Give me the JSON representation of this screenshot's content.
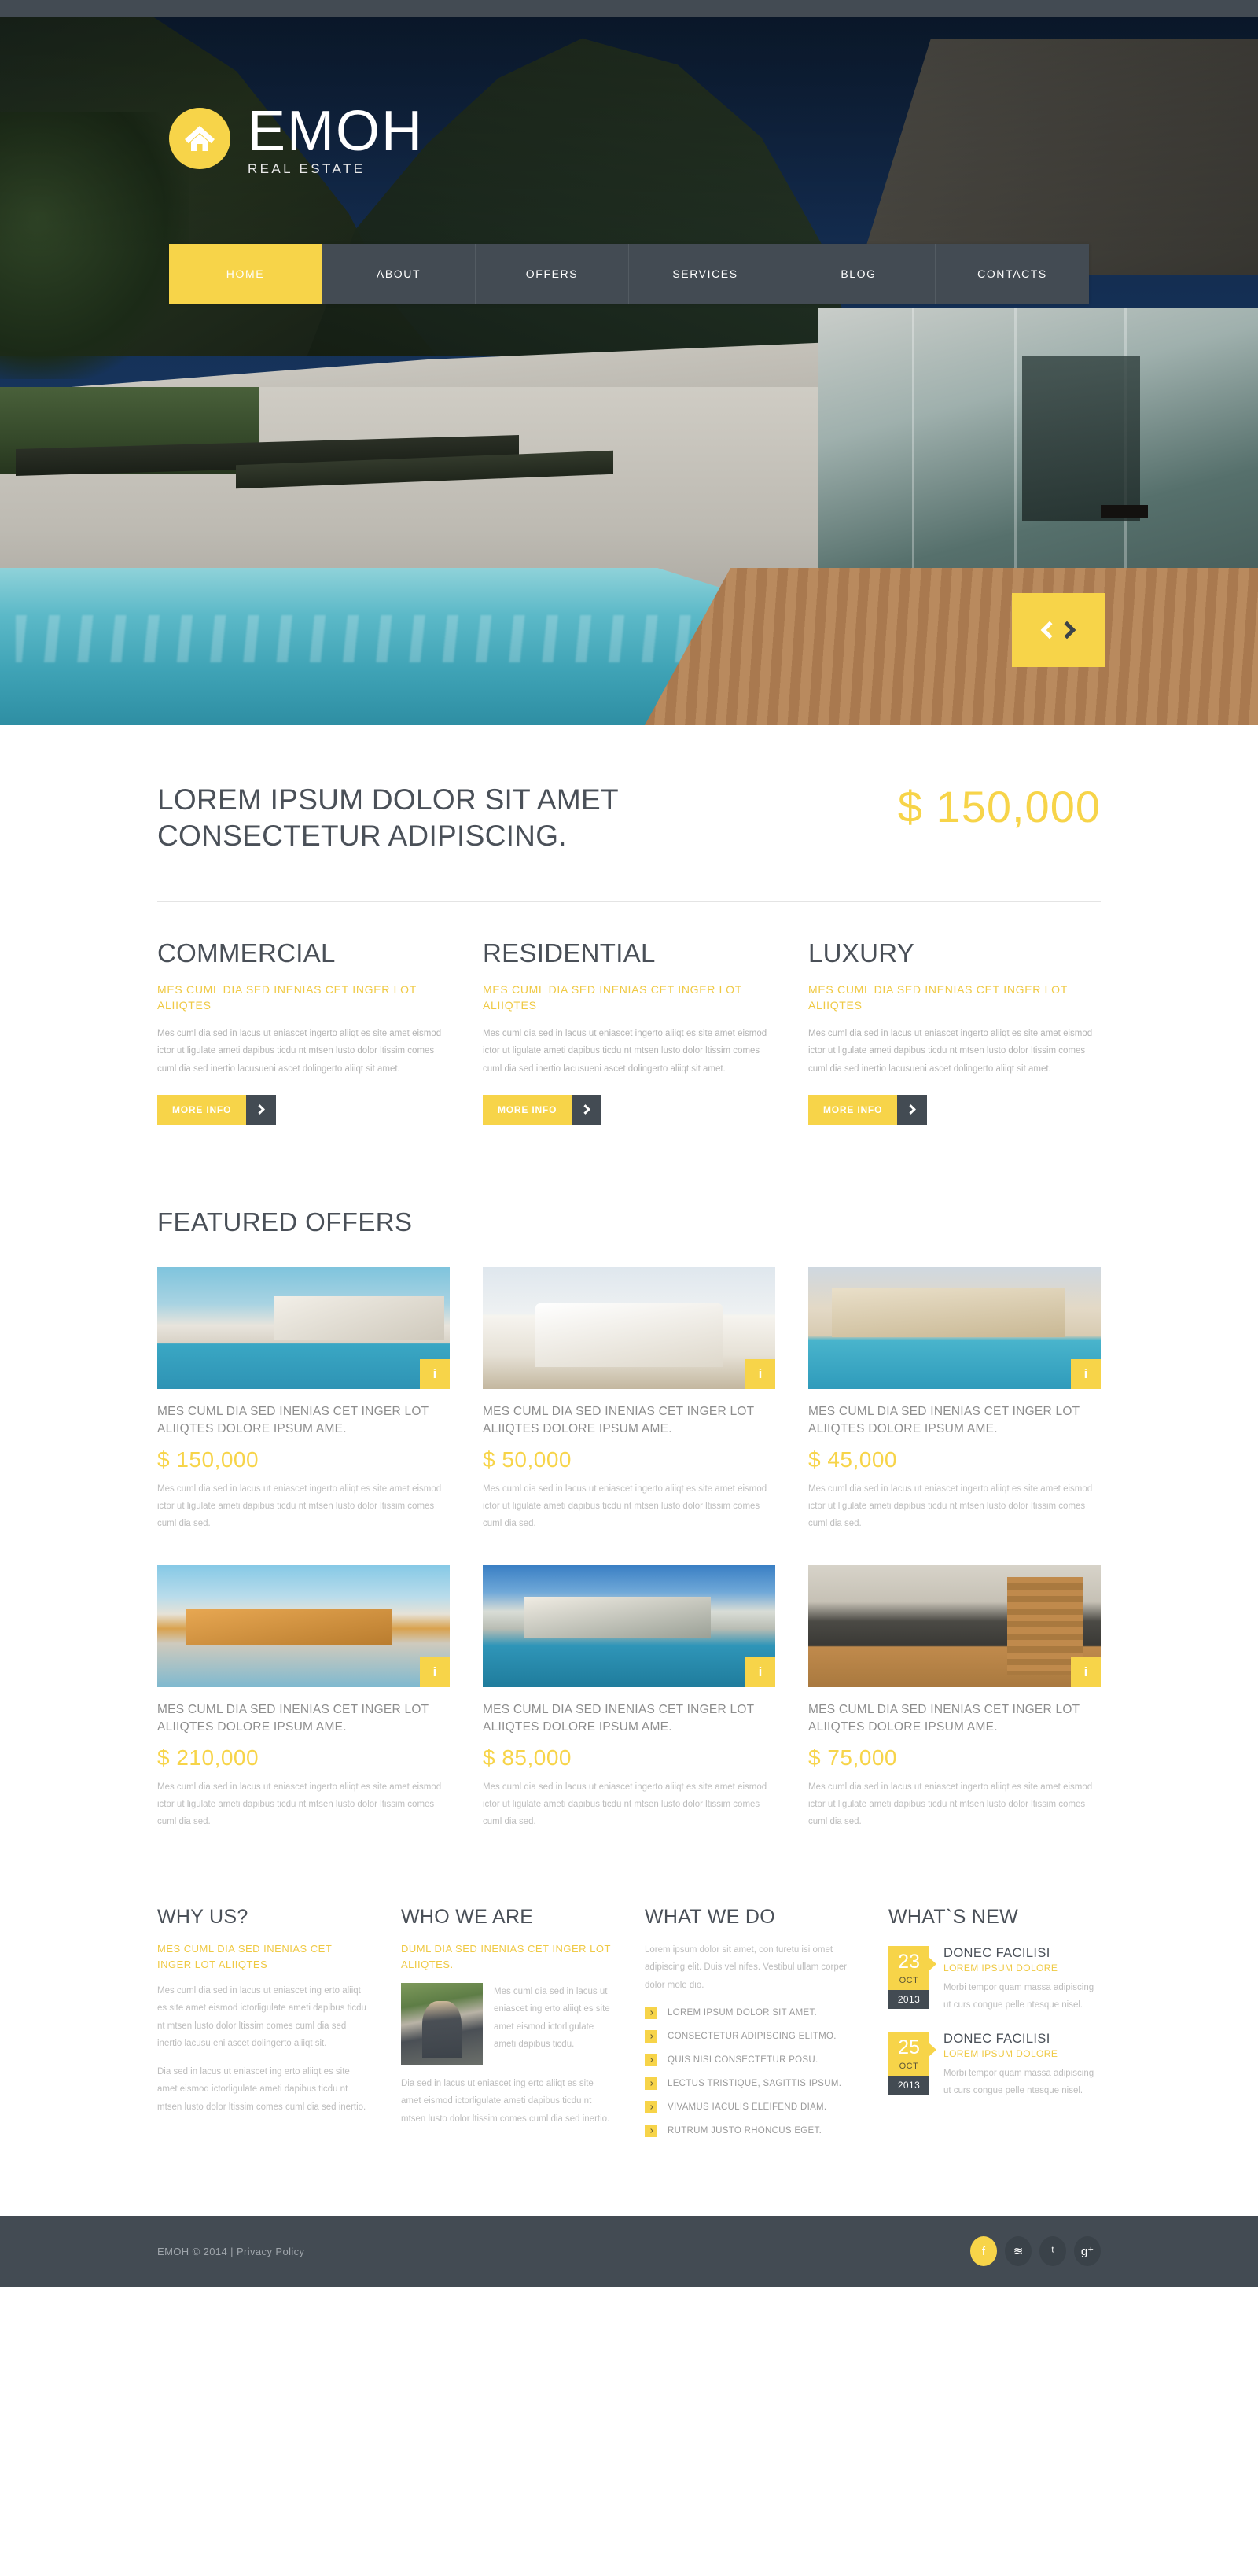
{
  "brand": {
    "name": "EMOH",
    "tagline": "REAL ESTATE",
    "logo_icon": "home-icon",
    "accent": "#f7d449",
    "dark": "#434b53"
  },
  "nav": {
    "items": [
      {
        "label": "HOME",
        "active": true
      },
      {
        "label": "ABOUT",
        "active": false
      },
      {
        "label": "OFFERS",
        "active": false
      },
      {
        "label": "SERVICES",
        "active": false
      },
      {
        "label": "BLOG",
        "active": false
      },
      {
        "label": "CONTACTS",
        "active": false
      }
    ]
  },
  "slider": {
    "prev_icon": "chevron-left-icon",
    "next_icon": "chevron-right-icon"
  },
  "intro": {
    "heading": "LOREM IPSUM DOLOR SIT AMET CONSECTETUR ADIPISCING.",
    "price": "$ 150,000"
  },
  "categories": [
    {
      "title": "COMMERCIAL",
      "subtitle": "MES CUML DIA SED INENIAS CET INGER LOT ALIIQTES",
      "body": "Mes cuml dia sed in lacus ut eniascet ingerto aliiqt es site amet eismod ictor ut ligulate ameti dapibus ticdu nt mtsen lusto dolor ltissim comes cuml dia sed inertio lacusueni ascet dolingerto aliiqt sit amet.",
      "button": "MORE INFO"
    },
    {
      "title": "RESIDENTIAL",
      "subtitle": "MES CUML DIA SED INENIAS CET INGER LOT ALIIQTES",
      "body": "Mes cuml dia sed in lacus ut eniascet ingerto aliiqt es site amet eismod ictor ut ligulate ameti dapibus ticdu nt mtsen lusto dolor ltissim comes cuml dia sed inertio lacusueni ascet dolingerto aliiqt sit amet.",
      "button": "MORE INFO"
    },
    {
      "title": "LUXURY",
      "subtitle": "MES CUML DIA SED INENIAS CET INGER LOT ALIIQTES",
      "body": "Mes cuml dia sed in lacus ut eniascet ingerto aliiqt es site amet eismod ictor ut ligulate ameti dapibus ticdu nt mtsen lusto dolor ltissim comes cuml dia sed inertio lacusueni ascet dolingerto aliiqt sit amet.",
      "button": "MORE INFO"
    }
  ],
  "featured": {
    "title": "FEATURED OFFERS",
    "badge_icon": "info-icon",
    "badge_label": "i",
    "items": [
      {
        "title": "MES CUML DIA SED INENIAS CET INGER LOT ALIIQTES DOLORE IPSUM AME.",
        "price": "$ 150,000",
        "body": "Mes cuml dia sed in lacus ut eniascet ingerto aliiqt es site amet eismod ictor ut ligulate ameti dapibus ticdu nt mtsen lusto dolor ltissim comes cuml dia sed."
      },
      {
        "title": "MES CUML DIA SED INENIAS CET INGER LOT ALIIQTES DOLORE IPSUM AME.",
        "price": "$ 50,000",
        "body": "Mes cuml dia sed in lacus ut eniascet ingerto aliiqt es site amet eismod ictor ut ligulate ameti dapibus ticdu nt mtsen lusto dolor ltissim comes cuml dia sed."
      },
      {
        "title": "MES CUML DIA SED INENIAS CET INGER LOT ALIIQTES DOLORE IPSUM AME.",
        "price": "$ 45,000",
        "body": "Mes cuml dia sed in lacus ut eniascet ingerto aliiqt es site amet eismod ictor ut ligulate ameti dapibus ticdu nt mtsen lusto dolor ltissim comes cuml dia sed."
      },
      {
        "title": "MES CUML DIA SED INENIAS CET INGER LOT ALIIQTES DOLORE IPSUM AME.",
        "price": "$ 210,000",
        "body": "Mes cuml dia sed in lacus ut eniascet ingerto aliiqt es site amet eismod ictor ut ligulate ameti dapibus ticdu nt mtsen lusto dolor ltissim comes cuml dia sed."
      },
      {
        "title": "MES CUML DIA SED INENIAS CET INGER LOT ALIIQTES DOLORE IPSUM AME.",
        "price": "$ 85,000",
        "body": "Mes cuml dia sed in lacus ut eniascet ingerto aliiqt es site amet eismod ictor ut ligulate ameti dapibus ticdu nt mtsen lusto dolor ltissim comes cuml dia sed."
      },
      {
        "title": "MES CUML DIA SED INENIAS CET INGER LOT ALIIQTES DOLORE IPSUM AME.",
        "price": "$ 75,000",
        "body": "Mes cuml dia sed in lacus ut eniascet ingerto aliiqt es site amet eismod ictor ut ligulate ameti dapibus ticdu nt mtsen lusto dolor ltissim comes cuml dia sed."
      }
    ]
  },
  "why_us": {
    "title": "WHY US?",
    "subtitle": "MES CUML DIA SED INENIAS CET INGER LOT ALIIQTES",
    "body1": "Mes cuml dia sed in lacus ut eniascet ing erto aliiqt es site amet eismod ictorligulate ameti dapibus ticdu nt mtsen lusto dolor ltissim comes cuml dia sed inertio lacusu eni ascet dolingerto aliiqt sit.",
    "body2": "Dia sed in lacus ut eniascet ing erto aliiqt es site amet eismod ictorligulate ameti dapibus ticdu nt mtsen lusto dolor ltissim comes cuml dia sed inertio."
  },
  "who_we_are": {
    "title": "WHO WE ARE",
    "subtitle": "DUML DIA SED INENIAS CET INGER LOT ALIIQTES.",
    "image_alt": "agent-photo",
    "body1": "Mes cuml dia sed in lacus ut eniascet ing erto aliiqt es site amet eismod ictorligulate ameti dapibus ticdu.",
    "body2": "Dia sed in lacus ut eniascet ing erto aliiqt es site amet eismod ictorligulate ameti dapibus ticdu nt mtsen lusto dolor ltissim comes cuml dia sed inertio."
  },
  "what_we_do": {
    "title": "WHAT WE DO",
    "intro": "Lorem ipsum dolor sit amet, con turetu isi omet adipiscing elit. Duis vel nifes. Vestibul ullam corper dolor mole dio.",
    "items": [
      "LOREM IPSUM DOLOR SIT AMET.",
      "CONSECTETUR ADIPISCING ELITMO.",
      "QUIS NISI CONSECTETUR POSU.",
      "LECTUS TRISTIQUE, SAGITTIS IPSUM.",
      "VIVAMUS IACULIS ELEIFEND DIAM.",
      "RUTRUM JUSTO RHONCUS EGET."
    ]
  },
  "whats_new": {
    "title": "WHAT`S NEW",
    "items": [
      {
        "day": "23",
        "month": "OCT",
        "year": "2013",
        "title": "DONEC FACILISI",
        "subtitle": "LOREM IPSUM DOLORE",
        "text": "Morbi tempor quam massa adipiscing ut curs congue pelle ntesque nisel."
      },
      {
        "day": "25",
        "month": "OCT",
        "year": "2013",
        "title": "DONEC FACILISI",
        "subtitle": "LOREM IPSUM DOLORE",
        "text": "Morbi tempor quam massa adipiscing ut curs congue pelle ntesque nisel."
      }
    ]
  },
  "footer": {
    "copyright": "EMOH © 2014 |",
    "privacy": "Privacy Policy",
    "socials": [
      {
        "name": "facebook-icon",
        "glyph": "f",
        "highlight": true
      },
      {
        "name": "rss-icon",
        "glyph": "≋",
        "highlight": false
      },
      {
        "name": "twitter-icon",
        "glyph": "ᵗ",
        "highlight": false
      },
      {
        "name": "google-plus-icon",
        "glyph": "g⁺",
        "highlight": false
      }
    ]
  }
}
